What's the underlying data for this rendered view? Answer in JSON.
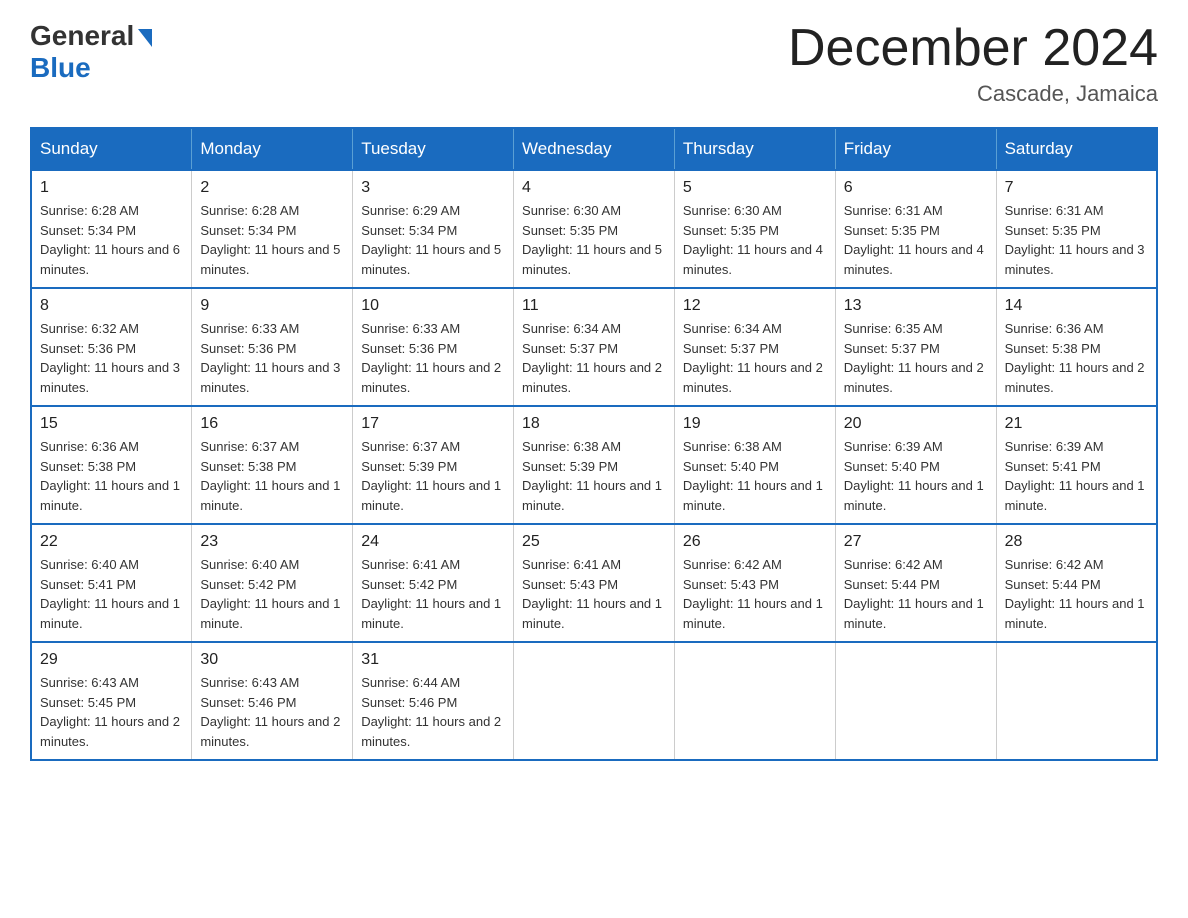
{
  "logo": {
    "general": "General",
    "blue": "Blue"
  },
  "title": "December 2024",
  "location": "Cascade, Jamaica",
  "days_of_week": [
    "Sunday",
    "Monday",
    "Tuesday",
    "Wednesday",
    "Thursday",
    "Friday",
    "Saturday"
  ],
  "weeks": [
    [
      {
        "day": "1",
        "info": "Sunrise: 6:28 AM\nSunset: 5:34 PM\nDaylight: 11 hours and 6 minutes."
      },
      {
        "day": "2",
        "info": "Sunrise: 6:28 AM\nSunset: 5:34 PM\nDaylight: 11 hours and 5 minutes."
      },
      {
        "day": "3",
        "info": "Sunrise: 6:29 AM\nSunset: 5:34 PM\nDaylight: 11 hours and 5 minutes."
      },
      {
        "day": "4",
        "info": "Sunrise: 6:30 AM\nSunset: 5:35 PM\nDaylight: 11 hours and 5 minutes."
      },
      {
        "day": "5",
        "info": "Sunrise: 6:30 AM\nSunset: 5:35 PM\nDaylight: 11 hours and 4 minutes."
      },
      {
        "day": "6",
        "info": "Sunrise: 6:31 AM\nSunset: 5:35 PM\nDaylight: 11 hours and 4 minutes."
      },
      {
        "day": "7",
        "info": "Sunrise: 6:31 AM\nSunset: 5:35 PM\nDaylight: 11 hours and 3 minutes."
      }
    ],
    [
      {
        "day": "8",
        "info": "Sunrise: 6:32 AM\nSunset: 5:36 PM\nDaylight: 11 hours and 3 minutes."
      },
      {
        "day": "9",
        "info": "Sunrise: 6:33 AM\nSunset: 5:36 PM\nDaylight: 11 hours and 3 minutes."
      },
      {
        "day": "10",
        "info": "Sunrise: 6:33 AM\nSunset: 5:36 PM\nDaylight: 11 hours and 2 minutes."
      },
      {
        "day": "11",
        "info": "Sunrise: 6:34 AM\nSunset: 5:37 PM\nDaylight: 11 hours and 2 minutes."
      },
      {
        "day": "12",
        "info": "Sunrise: 6:34 AM\nSunset: 5:37 PM\nDaylight: 11 hours and 2 minutes."
      },
      {
        "day": "13",
        "info": "Sunrise: 6:35 AM\nSunset: 5:37 PM\nDaylight: 11 hours and 2 minutes."
      },
      {
        "day": "14",
        "info": "Sunrise: 6:36 AM\nSunset: 5:38 PM\nDaylight: 11 hours and 2 minutes."
      }
    ],
    [
      {
        "day": "15",
        "info": "Sunrise: 6:36 AM\nSunset: 5:38 PM\nDaylight: 11 hours and 1 minute."
      },
      {
        "day": "16",
        "info": "Sunrise: 6:37 AM\nSunset: 5:38 PM\nDaylight: 11 hours and 1 minute."
      },
      {
        "day": "17",
        "info": "Sunrise: 6:37 AM\nSunset: 5:39 PM\nDaylight: 11 hours and 1 minute."
      },
      {
        "day": "18",
        "info": "Sunrise: 6:38 AM\nSunset: 5:39 PM\nDaylight: 11 hours and 1 minute."
      },
      {
        "day": "19",
        "info": "Sunrise: 6:38 AM\nSunset: 5:40 PM\nDaylight: 11 hours and 1 minute."
      },
      {
        "day": "20",
        "info": "Sunrise: 6:39 AM\nSunset: 5:40 PM\nDaylight: 11 hours and 1 minute."
      },
      {
        "day": "21",
        "info": "Sunrise: 6:39 AM\nSunset: 5:41 PM\nDaylight: 11 hours and 1 minute."
      }
    ],
    [
      {
        "day": "22",
        "info": "Sunrise: 6:40 AM\nSunset: 5:41 PM\nDaylight: 11 hours and 1 minute."
      },
      {
        "day": "23",
        "info": "Sunrise: 6:40 AM\nSunset: 5:42 PM\nDaylight: 11 hours and 1 minute."
      },
      {
        "day": "24",
        "info": "Sunrise: 6:41 AM\nSunset: 5:42 PM\nDaylight: 11 hours and 1 minute."
      },
      {
        "day": "25",
        "info": "Sunrise: 6:41 AM\nSunset: 5:43 PM\nDaylight: 11 hours and 1 minute."
      },
      {
        "day": "26",
        "info": "Sunrise: 6:42 AM\nSunset: 5:43 PM\nDaylight: 11 hours and 1 minute."
      },
      {
        "day": "27",
        "info": "Sunrise: 6:42 AM\nSunset: 5:44 PM\nDaylight: 11 hours and 1 minute."
      },
      {
        "day": "28",
        "info": "Sunrise: 6:42 AM\nSunset: 5:44 PM\nDaylight: 11 hours and 1 minute."
      }
    ],
    [
      {
        "day": "29",
        "info": "Sunrise: 6:43 AM\nSunset: 5:45 PM\nDaylight: 11 hours and 2 minutes."
      },
      {
        "day": "30",
        "info": "Sunrise: 6:43 AM\nSunset: 5:46 PM\nDaylight: 11 hours and 2 minutes."
      },
      {
        "day": "31",
        "info": "Sunrise: 6:44 AM\nSunset: 5:46 PM\nDaylight: 11 hours and 2 minutes."
      },
      null,
      null,
      null,
      null
    ]
  ]
}
